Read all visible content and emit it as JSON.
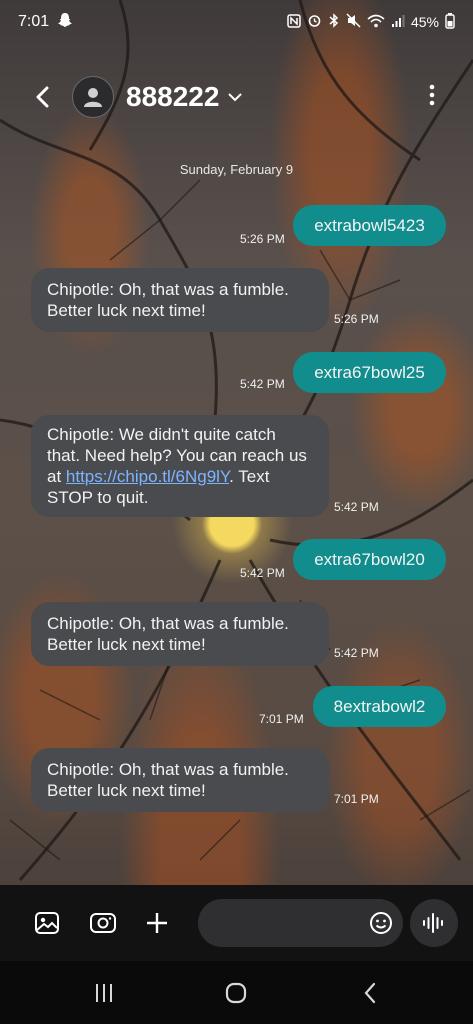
{
  "status_bar": {
    "time": "7:01",
    "battery": "45%",
    "icons": [
      "snapchat-ghost-icon",
      "nfc-icon",
      "alarm-icon",
      "bluetooth-icon",
      "mute-icon",
      "wifi-icon",
      "signal-icon",
      "battery-icon"
    ]
  },
  "header": {
    "contact": "888222",
    "icons": [
      "back-arrow-icon",
      "avatar-person-icon",
      "chevron-down-icon",
      "more-vert-icon"
    ]
  },
  "date_separator": "Sunday, February 9",
  "messages": [
    {
      "dir": "out",
      "text": "extrabowl5423",
      "time": "5:26 PM"
    },
    {
      "dir": "in",
      "text": "Chipotle: Oh, that was a fumble. Better luck next time!",
      "time": "5:26 PM"
    },
    {
      "dir": "out",
      "text": "extra67bowl25",
      "time": "5:42 PM"
    },
    {
      "dir": "in",
      "text_before": "Chipotle: We didn't quite catch that. Need help? You can reach us at ",
      "link": "https://chipo.tl/6Ng9lY",
      "text_after": ". Text STOP to quit.",
      "time": "5:42 PM"
    },
    {
      "dir": "out",
      "text": "extra67bowl20",
      "time": "5:42 PM"
    },
    {
      "dir": "in",
      "text": "Chipotle: Oh, that was a fumble. Better luck next time!",
      "time": "5:42 PM"
    },
    {
      "dir": "out",
      "text": "8extrabowl2",
      "time": "7:01 PM"
    },
    {
      "dir": "in",
      "text": "Chipotle: Oh, that was a fumble. Better luck next time!",
      "time": "7:01 PM"
    }
  ],
  "compose": {
    "placeholder": "",
    "icons": [
      "gallery-icon",
      "camera-icon",
      "plus-icon",
      "emoji-icon",
      "voice-record-icon"
    ]
  },
  "nav_bar": {
    "icons": [
      "recent-apps-icon",
      "home-icon",
      "back-nav-icon"
    ]
  },
  "colors": {
    "outgoing_bubble": "#118d8d",
    "incoming_bubble": "#4a4b4e",
    "link": "#7eb4ff",
    "compose_bg": "#121213",
    "nav_bg": "#0a0a0a"
  }
}
